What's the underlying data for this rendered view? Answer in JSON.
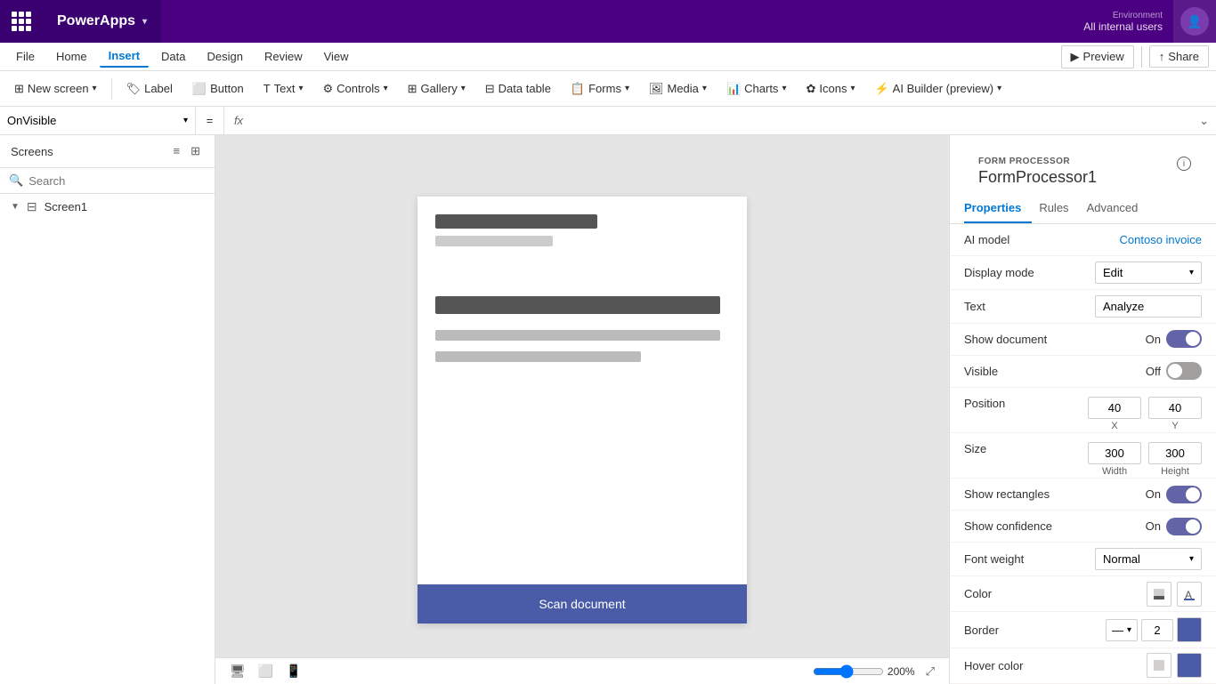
{
  "topbar": {
    "app_title": "PowerApps",
    "env_label": "Environment",
    "env_users": "All internal users"
  },
  "menubar": {
    "items": [
      "File",
      "Home",
      "Insert",
      "Data",
      "Design",
      "Review",
      "View"
    ],
    "active": "Insert",
    "preview_label": "Preview",
    "share_label": "Share"
  },
  "toolbar": {
    "new_screen": "New screen",
    "label": "Label",
    "button": "Button",
    "text": "Text",
    "controls": "Controls",
    "gallery": "Gallery",
    "data_table": "Data table",
    "forms": "Forms",
    "media": "Media",
    "charts": "Charts",
    "icons": "Icons",
    "ai_builder": "AI Builder (preview)"
  },
  "formula_bar": {
    "property": "OnVisible",
    "eq": "=",
    "fx": "fx"
  },
  "left_panel": {
    "title": "Screens",
    "search_placeholder": "Search",
    "screen_name": "Screen1"
  },
  "canvas": {
    "scan_button": "Scan document",
    "zoom_level": "200%"
  },
  "right_panel": {
    "section_title": "FORM PROCESSOR",
    "component_name": "FormProcessor1",
    "tabs": [
      "Properties",
      "Rules",
      "Advanced"
    ],
    "active_tab": "Properties",
    "properties": {
      "ai_model_label": "AI model",
      "ai_model_value": "Contoso invoice",
      "display_mode_label": "Display mode",
      "display_mode_value": "Edit",
      "text_label": "Text",
      "text_value": "Analyze",
      "show_document_label": "Show document",
      "show_document_on": "On",
      "show_document_state": true,
      "visible_label": "Visible",
      "visible_off": "Off",
      "visible_state": false,
      "position_label": "Position",
      "position_x": "40",
      "position_y": "40",
      "pos_x_label": "X",
      "pos_y_label": "Y",
      "size_label": "Size",
      "size_width": "300",
      "size_height": "300",
      "size_w_label": "Width",
      "size_h_label": "Height",
      "show_rectangles_label": "Show rectangles",
      "show_rectangles_on": "On",
      "show_rectangles_state": true,
      "show_confidence_label": "Show confidence",
      "show_confidence_on": "On",
      "show_confidence_state": true,
      "font_weight_label": "Font weight",
      "font_weight_value": "Normal",
      "color_label": "Color",
      "border_label": "Border",
      "border_width": "2",
      "hover_color_label": "Hover color"
    }
  }
}
